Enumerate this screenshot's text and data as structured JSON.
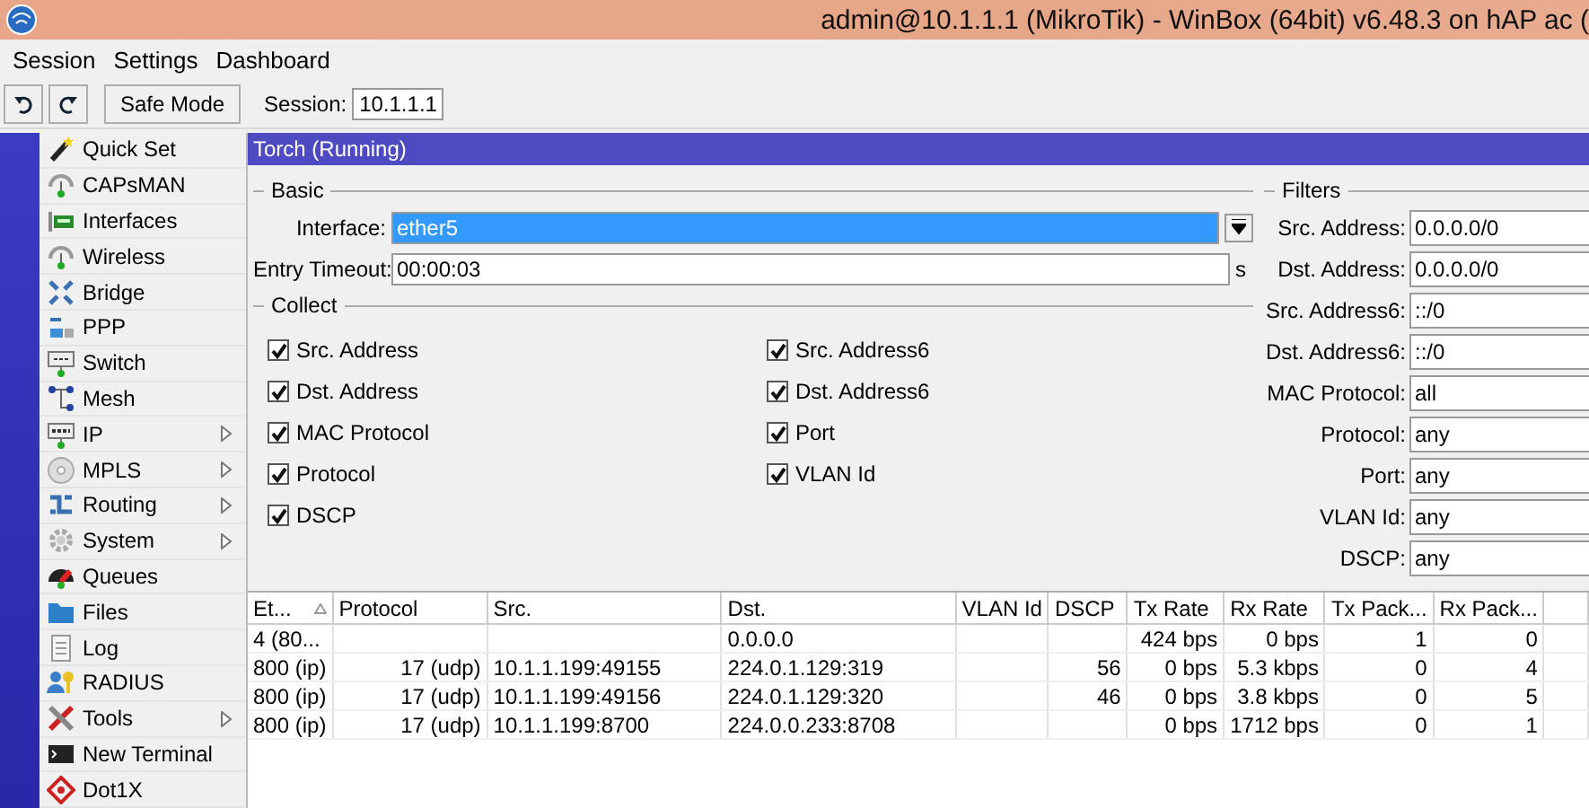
{
  "window": {
    "title": "admin@10.1.1.1 (MikroTik) - WinBox (64bit) v6.48.3 on hAP ac ("
  },
  "menu": [
    "Session",
    "Settings",
    "Dashboard"
  ],
  "toolbar": {
    "safe_mode": "Safe Mode",
    "session_label": "Session:",
    "session_value": "10.1.1.1"
  },
  "sidebar": {
    "items": [
      {
        "label": "Quick Set",
        "submenu": false
      },
      {
        "label": "CAPsMAN",
        "submenu": false
      },
      {
        "label": "Interfaces",
        "submenu": false
      },
      {
        "label": "Wireless",
        "submenu": false
      },
      {
        "label": "Bridge",
        "submenu": false
      },
      {
        "label": "PPP",
        "submenu": false
      },
      {
        "label": "Switch",
        "submenu": false
      },
      {
        "label": "Mesh",
        "submenu": false
      },
      {
        "label": "IP",
        "submenu": true
      },
      {
        "label": "MPLS",
        "submenu": true
      },
      {
        "label": "Routing",
        "submenu": true
      },
      {
        "label": "System",
        "submenu": true
      },
      {
        "label": "Queues",
        "submenu": false
      },
      {
        "label": "Files",
        "submenu": false
      },
      {
        "label": "Log",
        "submenu": false
      },
      {
        "label": "RADIUS",
        "submenu": false
      },
      {
        "label": "Tools",
        "submenu": true
      },
      {
        "label": "New Terminal",
        "submenu": false
      },
      {
        "label": "Dot1X",
        "submenu": false
      }
    ]
  },
  "torch": {
    "title": "Torch (Running)",
    "basic": {
      "legend": "Basic",
      "interface": {
        "label": "Interface:",
        "value": "ether5",
        "highlighted": true
      },
      "entry_timeout": {
        "label": "Entry Timeout:",
        "value": "00:00:03",
        "unit": "s"
      }
    },
    "collect": {
      "legend": "Collect",
      "items": [
        {
          "label": "Src. Address",
          "checked": true
        },
        {
          "label": "Src. Address6",
          "checked": true
        },
        {
          "label": "Dst. Address",
          "checked": true
        },
        {
          "label": "Dst. Address6",
          "checked": true
        },
        {
          "label": "MAC Protocol",
          "checked": true
        },
        {
          "label": "Port",
          "checked": true
        },
        {
          "label": "Protocol",
          "checked": true
        },
        {
          "label": "VLAN Id",
          "checked": true
        },
        {
          "label": "DSCP",
          "checked": true
        }
      ]
    },
    "filters": {
      "legend": "Filters",
      "fields": [
        {
          "label": "Src. Address:",
          "value": "0.0.0.0/0"
        },
        {
          "label": "Dst. Address:",
          "value": "0.0.0.0/0"
        },
        {
          "label": "Src. Address6:",
          "value": "::/0"
        },
        {
          "label": "Dst. Address6:",
          "value": "::/0"
        },
        {
          "label": "MAC Protocol:",
          "value": "all"
        },
        {
          "label": "Protocol:",
          "value": "any"
        },
        {
          "label": "Port:",
          "value": "any"
        },
        {
          "label": "VLAN Id:",
          "value": "any"
        },
        {
          "label": "DSCP:",
          "value": "any"
        }
      ]
    }
  },
  "table": {
    "columns": [
      {
        "label": "Et...",
        "sorted": true
      },
      {
        "label": "Protocol",
        "sorted": false
      },
      {
        "label": "Src.",
        "sorted": false
      },
      {
        "label": "Dst.",
        "sorted": false
      },
      {
        "label": "VLAN Id",
        "sorted": false
      },
      {
        "label": "DSCP",
        "sorted": false
      },
      {
        "label": "Tx Rate",
        "sorted": false
      },
      {
        "label": "Rx Rate",
        "sorted": false
      },
      {
        "label": "Tx Pack...",
        "sorted": false
      },
      {
        "label": "Rx Pack...",
        "sorted": false
      }
    ],
    "rows": [
      [
        "4 (80...",
        "",
        "",
        "0.0.0.0",
        "",
        "",
        "424 bps",
        "0 bps",
        "1",
        "0"
      ],
      [
        "800 (ip)",
        "17 (udp)",
        "10.1.1.199:49155",
        "224.0.1.129:319",
        "",
        "56",
        "0 bps",
        "5.3 kbps",
        "0",
        "4"
      ],
      [
        "800 (ip)",
        "17 (udp)",
        "10.1.1.199:49156",
        "224.0.1.129:320",
        "",
        "46",
        "0 bps",
        "3.8 kbps",
        "0",
        "5"
      ],
      [
        "800 (ip)",
        "17 (udp)",
        "10.1.1.199:8700",
        "224.0.0.233:8708",
        "",
        "",
        "0 bps",
        "1712 bps",
        "0",
        "1"
      ]
    ]
  }
}
